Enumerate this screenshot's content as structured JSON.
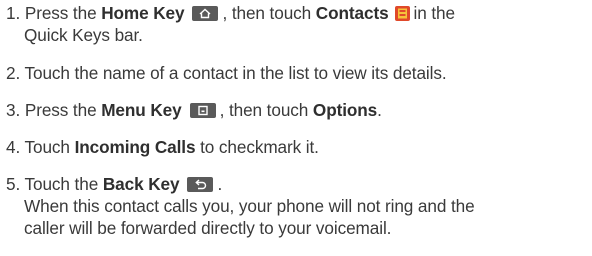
{
  "steps": [
    {
      "num": "1.",
      "pre": "Press the",
      "key1": "Home Key",
      "mid": ", then touch",
      "key2": "Contacts",
      "post": "in the",
      "cont": "Quick Keys bar."
    },
    {
      "num": "2.",
      "text": "Touch the name of a contact in the list to view its details."
    },
    {
      "num": "3.",
      "pre": "Press the",
      "key1": "Menu Key",
      "mid": ", then touch",
      "key2": "Options",
      "post": "."
    },
    {
      "num": "4.",
      "pre": "Touch",
      "key1": "Incoming Calls",
      "post": "to checkmark it."
    },
    {
      "num": "5.",
      "pre": "Touch the",
      "key1": "Back Key",
      "post": ".",
      "cont1": "When this contact calls you, your phone will not ring and the",
      "cont2": "caller will be forwarded directly to your voicemail."
    }
  ],
  "icons": [
    "home-key-icon",
    "contacts-app-icon",
    "menu-key-icon",
    "back-key-icon"
  ]
}
